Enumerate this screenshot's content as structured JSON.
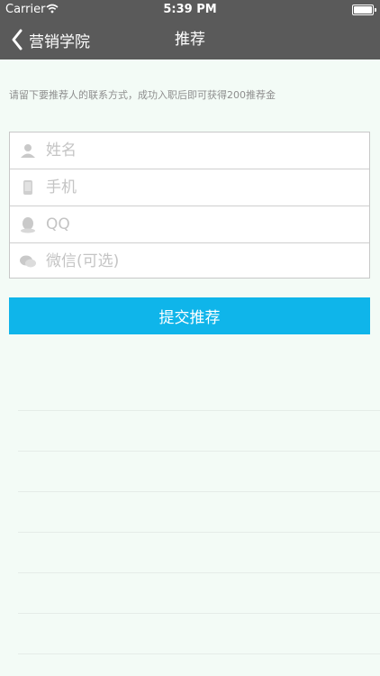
{
  "status_bar": {
    "carrier": "Carrier",
    "time": "5:39 PM"
  },
  "nav": {
    "back_label": "营销学院",
    "title": "推荐"
  },
  "hint": "请留下要推荐人的联系方式，成功入职后即可获得200推荐金",
  "form": {
    "fields": [
      {
        "placeholder": "姓名",
        "icon": "person-icon"
      },
      {
        "placeholder": "手机",
        "icon": "phone-icon"
      },
      {
        "placeholder": "QQ",
        "icon": "qq-icon"
      },
      {
        "placeholder": "微信(可选)",
        "icon": "wechat-icon"
      }
    ]
  },
  "submit_label": "提交推荐",
  "colors": {
    "nav_background": "#5a5a5a",
    "accent": "#0fb5ea",
    "page_background": "#f3fbf6"
  }
}
